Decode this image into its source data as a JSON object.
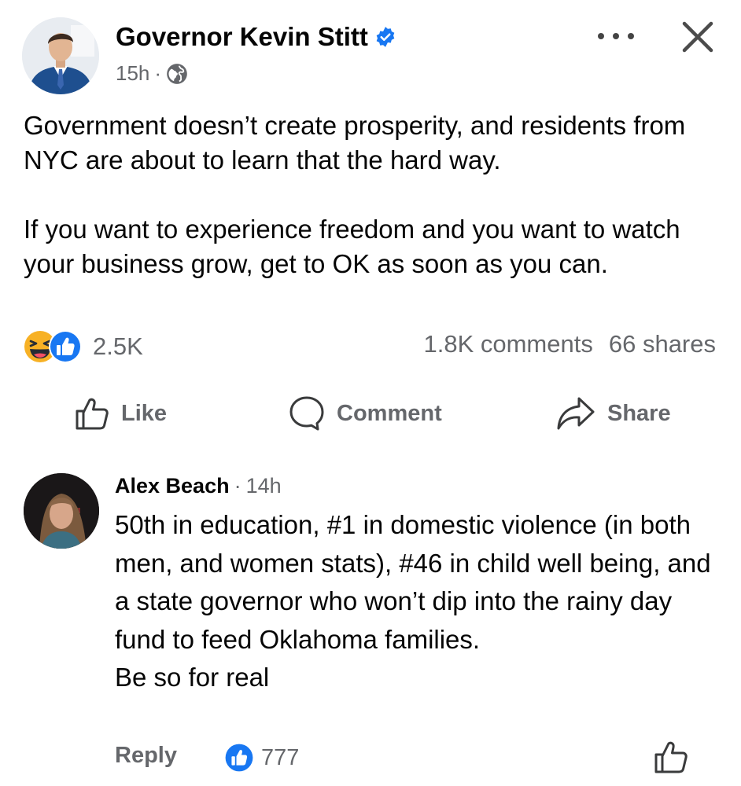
{
  "post": {
    "author": "Governor Kevin Stitt",
    "time": "15h",
    "separator": "·",
    "paragraphs": [
      "Government doesn’t create prosperity, and residents from NYC are about to learn that the hard way.",
      "If you want to experience freedom and you want to watch your business grow, get to OK as soon as you can."
    ],
    "reaction_count": "2.5K",
    "comments_count": "1.8K comments",
    "shares_count": "66 shares"
  },
  "actions": {
    "like": "Like",
    "comment": "Comment",
    "share": "Share"
  },
  "comment": {
    "author": "Alex Beach",
    "separator": "·",
    "time": "14h",
    "text": "50th in education, #1 in domestic violence (in both men, and women stats), #46 in child well being, and a state governor who won’t dip into the rainy day fund to feed Oklahoma families.\nBe so for real",
    "reply_label": "Reply",
    "like_count": "777"
  },
  "icons": {
    "verified": "verified-badge-icon",
    "audience": "globe-icon",
    "more": "more-options-icon",
    "close": "close-icon",
    "haha": "haha-reaction-icon",
    "like_reaction": "like-reaction-icon",
    "like": "thumbs-up-icon",
    "comment": "speech-bubble-icon",
    "share": "share-arrow-icon"
  },
  "colors": {
    "text": "#050505",
    "secondary": "#65676b",
    "facebook_blue": "#1877f2",
    "haha_yellow": "#f7b125"
  }
}
